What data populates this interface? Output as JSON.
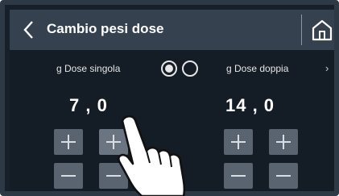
{
  "header": {
    "title": "Cambio pesi dose"
  },
  "single": {
    "label": "g Dose singola",
    "value": "7 , 0"
  },
  "double": {
    "label": "g Dose doppia",
    "value": "14 , 0"
  },
  "icons": {
    "back": "chevron-left-icon",
    "home": "home-icon",
    "next": "chevron-right-icon",
    "hand": "touch-hand-icon"
  },
  "radio": {
    "selected": "first"
  }
}
